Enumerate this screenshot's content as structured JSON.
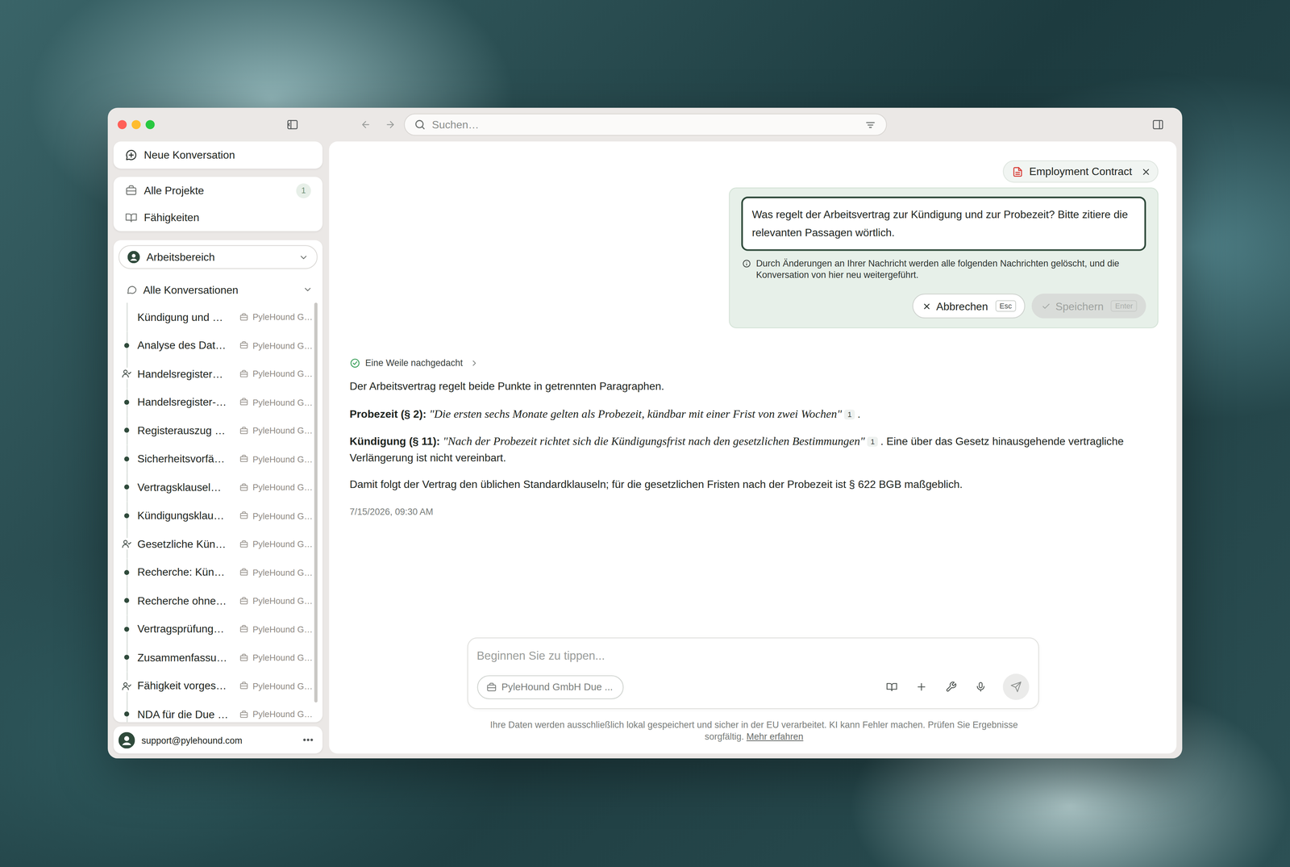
{
  "toolbar": {
    "search_placeholder": "Suchen…"
  },
  "sidebar": {
    "new_conversation": "Neue Konversation",
    "nav": [
      {
        "label": "Alle Projekte",
        "badge": "1",
        "kind": "projects"
      },
      {
        "label": "Fähigkeiten",
        "badge": "",
        "kind": "skills"
      }
    ],
    "workspace": "Arbeitsbereich",
    "conversations": {
      "label": "Alle Konversationen",
      "expanded": true,
      "items": [
        {
          "title": "Kündigung und …",
          "project": "PyleHound G…",
          "kind": "plain"
        },
        {
          "title": "Analyse des Dat…",
          "project": "PyleHound G…",
          "kind": "dot"
        },
        {
          "title": "Handelsregister…",
          "project": "PyleHound G…",
          "kind": "shared"
        },
        {
          "title": "Handelsregister-…",
          "project": "PyleHound G…",
          "kind": "dot"
        },
        {
          "title": "Registerauszug …",
          "project": "PyleHound G…",
          "kind": "dot"
        },
        {
          "title": "Sicherheitsvorfä…",
          "project": "PyleHound G…",
          "kind": "dot"
        },
        {
          "title": "Vertragsklausel…",
          "project": "PyleHound G…",
          "kind": "dot"
        },
        {
          "title": "Kündigungsklau…",
          "project": "PyleHound G…",
          "kind": "dot"
        },
        {
          "title": "Gesetzliche Kün…",
          "project": "PyleHound G…",
          "kind": "shared"
        },
        {
          "title": "Recherche: Kün…",
          "project": "PyleHound G…",
          "kind": "dot"
        },
        {
          "title": "Recherche ohne…",
          "project": "PyleHound G…",
          "kind": "dot"
        },
        {
          "title": "Vertragsprüfung…",
          "project": "PyleHound G…",
          "kind": "dot"
        },
        {
          "title": "Zusammenfassu…",
          "project": "PyleHound G…",
          "kind": "dot"
        },
        {
          "title": "Fähigkeit vorges…",
          "project": "PyleHound G…",
          "kind": "shared"
        },
        {
          "title": "NDA für die Due …",
          "project": "PyleHound G…",
          "kind": "dot"
        }
      ]
    },
    "user": "support@pylehound.com"
  },
  "attachment": {
    "label": "Employment Contract"
  },
  "edit": {
    "value": "Was regelt der Arbeitsvertrag zur Kündigung und zur Probezeit? Bitte zitiere die relevanten Passagen wörtlich.",
    "notice": "Durch Änderungen an Ihrer Nachricht werden alle folgenden Nachrichten gelöscht, und die Konversation von hier neu weitergeführt.",
    "buttons": [
      {
        "label": "Abbrechen",
        "key": "Esc",
        "disabled": false,
        "kind": "cancel"
      },
      {
        "label": "Speichern",
        "key": "Enter",
        "disabled": true,
        "kind": "save"
      }
    ]
  },
  "response": {
    "thinking": "Eine Weile nachgedacht",
    "intro": "Der Arbeitsvertrag regelt beide Punkte in getrennten Paragraphen.",
    "sections": [
      {
        "label": "Probezeit (§ 2):",
        "quote": "\"Die ersten sechs Monate gelten als Probezeit, kündbar mit einer Frist von zwei Wochen\"",
        "citation": "1",
        "tail": "."
      },
      {
        "label": "Kündigung (§ 11):",
        "quote": "\"Nach der Probezeit richtet sich die Kündigungsfrist nach den gesetzlichen Bestimmungen\"",
        "citation": "1",
        "tail": ". Eine über das Gesetz hinausgehende vertragliche Verlängerung ist nicht vereinbart."
      }
    ],
    "conclusion": "Damit folgt der Vertrag den üblichen Standardklauseln; für die gesetzlichen Fristen nach der Probezeit ist § 622 BGB maßgeblich.",
    "timestamp": "7/15/2026, 09:30 AM"
  },
  "composer": {
    "placeholder": "Beginnen Sie zu tippen...",
    "project": "PyleHound GmbH Due ..."
  },
  "footer": {
    "text": "Ihre Daten werden ausschließlich lokal gespeichert und sicher in der EU verarbeitet. KI kann Fehler machen. Prüfen Sie Ergebnisse sorgfältig.",
    "link": "Mehr erfahren"
  }
}
